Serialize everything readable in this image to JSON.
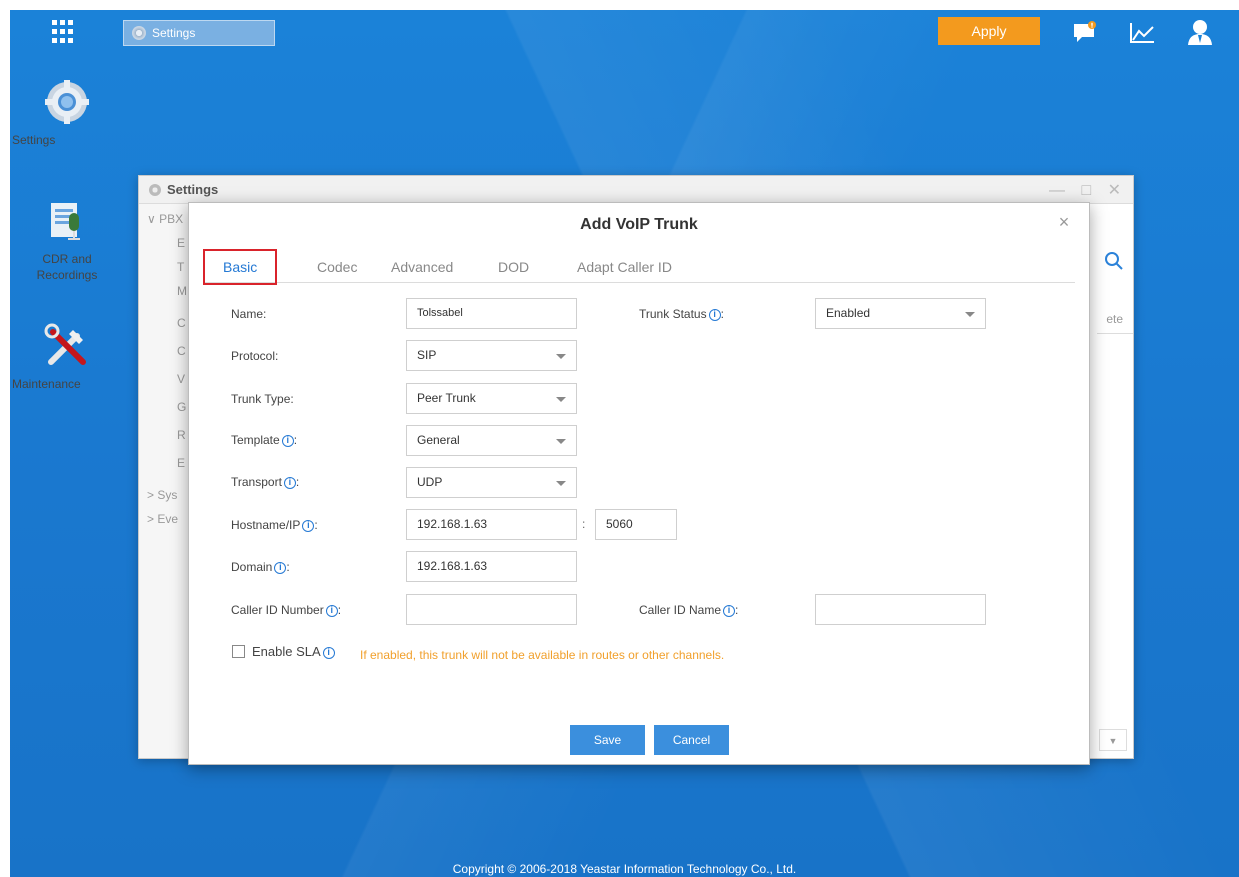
{
  "topbar": {
    "tab_label": "Settings",
    "apply_label": "Apply"
  },
  "desktop_icons": [
    {
      "label": "Settings"
    },
    {
      "label": "CDR and Recordings"
    },
    {
      "label": "Maintenance"
    }
  ],
  "settings_window": {
    "title": "Settings",
    "sidebar": [
      "PBX",
      "E",
      "T",
      "M",
      "C",
      "C",
      "V",
      "G",
      "R",
      "E",
      "Sys",
      "Eve"
    ],
    "partial_label": "ete"
  },
  "dialog": {
    "title": "Add VoIP Trunk",
    "tabs": [
      "Basic",
      "Codec",
      "Advanced",
      "DOD",
      "Adapt Caller ID"
    ],
    "active_tab": "Basic",
    "fields": {
      "name_label": "Name:",
      "name_value": "Tolssabel",
      "trunk_status_label": "Trunk Status",
      "trunk_status_value": "Enabled",
      "protocol_label": "Protocol:",
      "protocol_value": "SIP",
      "trunk_type_label": "Trunk Type:",
      "trunk_type_value": "Peer Trunk",
      "template_label": "Template",
      "template_value": "General",
      "transport_label": "Transport",
      "transport_value": "UDP",
      "hostname_label": "Hostname/IP",
      "hostname_value": "192.168.1.63",
      "port_value": "5060",
      "domain_label": "Domain",
      "domain_value": "192.168.1.63",
      "caller_id_number_label": "Caller ID Number",
      "caller_id_number_value": "",
      "caller_id_name_label": "Caller ID Name",
      "caller_id_name_value": ""
    },
    "sla": {
      "label": "Enable SLA",
      "checked": false,
      "note": "If enabled, this trunk will not be available in routes or other channels."
    },
    "buttons": {
      "save": "Save",
      "cancel": "Cancel"
    }
  },
  "footer": "Copyright © 2006-2018 Yeastar Information Technology Co., Ltd.",
  "colors": {
    "accent": "#2579d4",
    "apply": "#f39a1e",
    "warning": "#f1a02c",
    "desktop": "#1b82d8"
  }
}
